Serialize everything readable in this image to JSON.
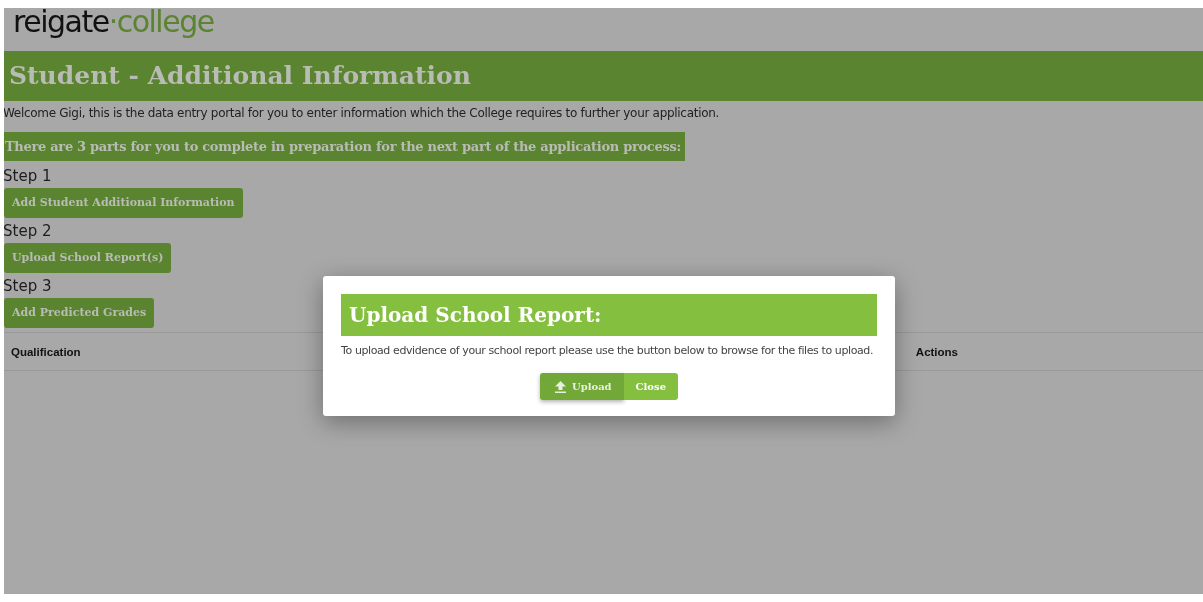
{
  "logo": {
    "name": "reigate",
    "suffix": "·college"
  },
  "page_title": "Student - Additional Information",
  "welcome": "Welcome Gigi, this is the data entry portal for you to enter information which the College requires to further your application.",
  "banner": "There are 3 parts for you to complete in preparation for the next part of the application process:",
  "steps": [
    {
      "label": "Step 1",
      "button": "Add Student Additional Information"
    },
    {
      "label": "Step 2",
      "button": "Upload School Report(s)"
    },
    {
      "label": "Step 3",
      "button": "Add Predicted Grades"
    }
  ],
  "table": {
    "columns": [
      "Qualification",
      "Actions"
    ]
  },
  "modal": {
    "title": "Upload School Report:",
    "message": "To upload edvidence of your school report please use the button below to browse for the files to upload.",
    "buttons": [
      {
        "label": "Upload",
        "kind": "upload"
      },
      {
        "label": "Close",
        "kind": "plain"
      }
    ]
  }
}
